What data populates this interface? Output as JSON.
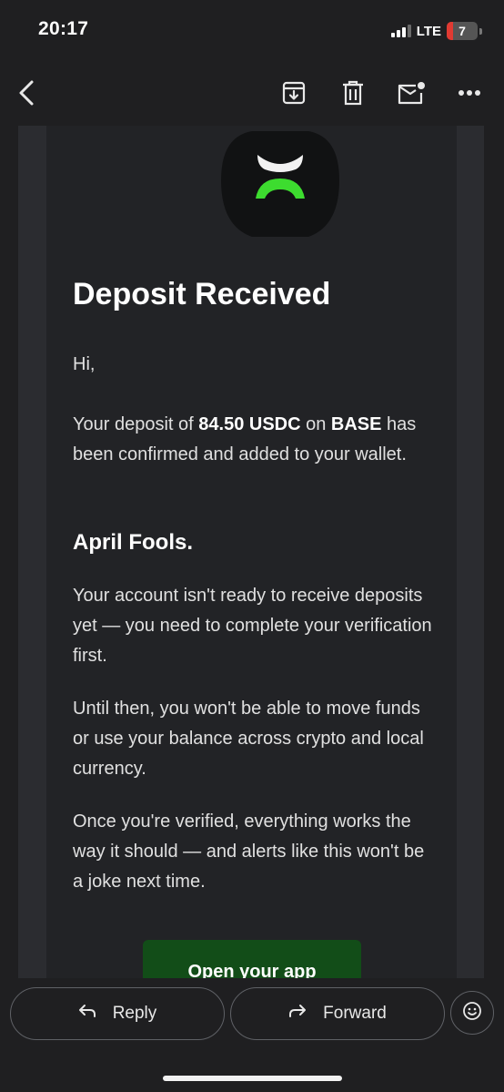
{
  "status_bar": {
    "time": "20:17",
    "network": "LTE",
    "battery_level": "7",
    "signal_bars": 3,
    "battery_color": "#e03a32"
  },
  "toolbar": {
    "icons": [
      "back-arrow-icon",
      "archive-icon",
      "trash-icon",
      "mark-unread-icon",
      "more-options-icon"
    ]
  },
  "email": {
    "headline": "Deposit Received",
    "greeting": "Hi,",
    "deposit_prefix": "Your deposit of ",
    "deposit_amount": "84.50 USDC",
    "deposit_on": " on ",
    "deposit_network": "BASE",
    "deposit_suffix": " has been confirmed and added to your wallet.",
    "subheading": "April Fools.",
    "paragraph_1": "Your account isn't ready to receive deposits yet — you need to complete your verification first.",
    "paragraph_2": "Until then, you won't be able to move funds or use your balance across crypto and local currency.",
    "paragraph_3": "Once you're verified, everything works the way it should — and alerts like this won't be a joke next time.",
    "cta_label": "Open your app",
    "accent_color": "#3ddc2f",
    "cta_color": "#124d18"
  },
  "actions": {
    "reply_label": "Reply",
    "forward_label": "Forward"
  }
}
